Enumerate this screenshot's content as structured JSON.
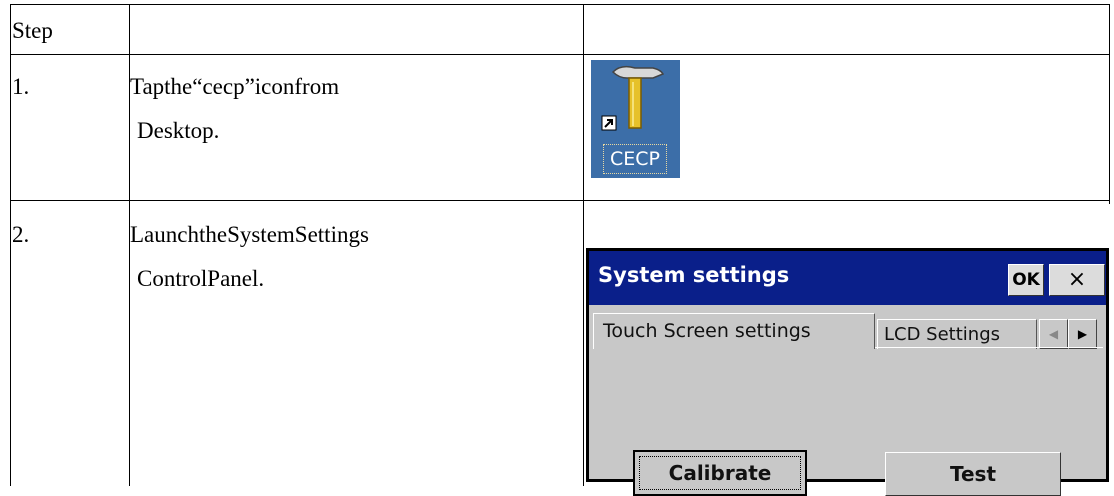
{
  "table": {
    "header": {
      "step": "Step",
      "col2": "",
      "col3": ""
    },
    "rows": [
      {
        "num": "1.",
        "line1": "Tapthe“cecp”iconfrom",
        "line2": "Desktop."
      },
      {
        "num": "2.",
        "line1": "LaunchtheSystemSettings",
        "line2": "ControlPanel."
      }
    ]
  },
  "cecp_icon": {
    "label": "CECP",
    "icon": "hammer-icon",
    "shortcut_icon": "shortcut-arrow-icon"
  },
  "dialog": {
    "title": "System settings",
    "ok_label": "OK",
    "close_label": "×",
    "tabs": [
      {
        "label": "Touch Screen settings",
        "active": true
      },
      {
        "label": "LCD Settings",
        "active": false
      }
    ],
    "scroll_left": "◀",
    "scroll_right": "▶",
    "calibrate_label": "Calibrate",
    "test_label": "Test",
    "colors": {
      "titlebar": "#0a1f8a",
      "face": "#c8c8c8"
    }
  }
}
